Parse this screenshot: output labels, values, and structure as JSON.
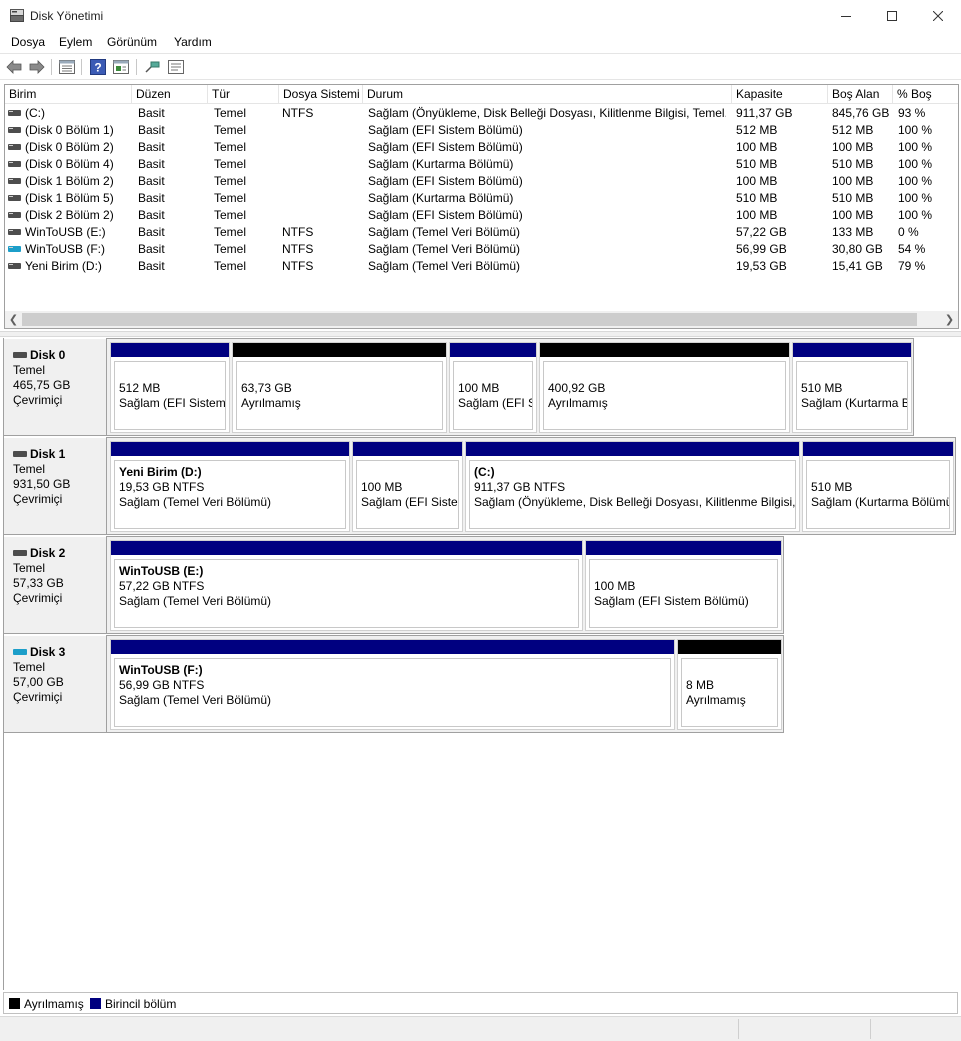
{
  "window": {
    "title": "Disk Yönetimi"
  },
  "menu": [
    "Dosya",
    "Eylem",
    "Görünüm",
    "Yardım"
  ],
  "toolbar": {
    "icons": [
      "back-arrow-icon",
      "forward-arrow-icon",
      "volume-list-icon",
      "help-icon",
      "properties-icon",
      "connect-icon",
      "console-icon"
    ]
  },
  "list": {
    "headers": [
      "Birim",
      "Düzen",
      "Tür",
      "Dosya Sistemi",
      "Durum",
      "Kapasite",
      "Boş Alan",
      "% Boş"
    ],
    "rows": [
      {
        "icon": "drive",
        "cells": [
          "(C:)",
          "Basit",
          "Temel",
          "NTFS",
          "Sağlam (Önyükleme, Disk Belleği Dosyası, Kilitlenme Bilgisi, Temel...",
          "911,37 GB",
          "845,76 GB",
          "93 %"
        ]
      },
      {
        "icon": "drive",
        "cells": [
          "(Disk 0 Bölüm 1)",
          "Basit",
          "Temel",
          "",
          "Sağlam (EFI Sistem Bölümü)",
          "512 MB",
          "512 MB",
          "100 %"
        ]
      },
      {
        "icon": "drive",
        "cells": [
          "(Disk 0 Bölüm 2)",
          "Basit",
          "Temel",
          "",
          "Sağlam (EFI Sistem Bölümü)",
          "100 MB",
          "100 MB",
          "100 %"
        ]
      },
      {
        "icon": "drive",
        "cells": [
          "(Disk 0 Bölüm 4)",
          "Basit",
          "Temel",
          "",
          "Sağlam (Kurtarma Bölümü)",
          "510 MB",
          "510 MB",
          "100 %"
        ]
      },
      {
        "icon": "drive",
        "cells": [
          "(Disk 1 Bölüm 2)",
          "Basit",
          "Temel",
          "",
          "Sağlam (EFI Sistem Bölümü)",
          "100 MB",
          "100 MB",
          "100 %"
        ]
      },
      {
        "icon": "drive",
        "cells": [
          "(Disk 1 Bölüm 5)",
          "Basit",
          "Temel",
          "",
          "Sağlam (Kurtarma Bölümü)",
          "510 MB",
          "510 MB",
          "100 %"
        ]
      },
      {
        "icon": "drive",
        "cells": [
          "(Disk 2 Bölüm 2)",
          "Basit",
          "Temel",
          "",
          "Sağlam (EFI Sistem Bölümü)",
          "100 MB",
          "100 MB",
          "100 %"
        ]
      },
      {
        "icon": "drive",
        "cells": [
          "WinToUSB (E:)",
          "Basit",
          "Temel",
          "NTFS",
          "Sağlam (Temel Veri Bölümü)",
          "57,22 GB",
          "133 MB",
          "0 %"
        ]
      },
      {
        "icon": "usb",
        "cells": [
          "WinToUSB (F:)",
          "Basit",
          "Temel",
          "NTFS",
          "Sağlam (Temel Veri Bölümü)",
          "56,99 GB",
          "30,80 GB",
          "54 %"
        ]
      },
      {
        "icon": "drive",
        "cells": [
          "Yeni Birim (D:)",
          "Basit",
          "Temel",
          "NTFS",
          "Sağlam (Temel Veri Bölümü)",
          "19,53 GB",
          "15,41 GB",
          "79 %"
        ]
      }
    ]
  },
  "disks": [
    {
      "name": "Disk 0",
      "type": "Temel",
      "size": "465,75 GB",
      "state": "Çevrimiçi",
      "icon": "drive",
      "partitions": [
        {
          "kind": "primary",
          "name": "",
          "line1": "512 MB",
          "line2": "Sağlam (EFI Sistem Bölümü)"
        },
        {
          "kind": "unalloc",
          "name": "",
          "line1": "63,73 GB",
          "line2": "Ayrılmamış"
        },
        {
          "kind": "primary",
          "name": "",
          "line1": "100 MB",
          "line2": "Sağlam (EFI Sistem Bölümü)"
        },
        {
          "kind": "unalloc",
          "name": "",
          "line1": "400,92 GB",
          "line2": "Ayrılmamış"
        },
        {
          "kind": "primary",
          "name": "",
          "line1": "510 MB",
          "line2": "Sağlam (Kurtarma Bölümü)"
        }
      ]
    },
    {
      "name": "Disk 1",
      "type": "Temel",
      "size": "931,50 GB",
      "state": "Çevrimiçi",
      "icon": "drive",
      "partitions": [
        {
          "kind": "primary",
          "name": "Yeni Birim  (D:)",
          "line1": "19,53 GB NTFS",
          "line2": "Sağlam (Temel Veri Bölümü)"
        },
        {
          "kind": "primary",
          "name": "",
          "line1": "100 MB",
          "line2": "Sağlam (EFI Sistem Bölümü)"
        },
        {
          "kind": "primary",
          "name": " (C:)",
          "line1": "911,37 GB NTFS",
          "line2": "Sağlam (Önyükleme, Disk Belleği Dosyası, Kilitlenme Bilgisi, Temel Veri Bölümü)"
        },
        {
          "kind": "primary",
          "name": "",
          "line1": "510 MB",
          "line2": "Sağlam (Kurtarma Bölümü)"
        }
      ]
    },
    {
      "name": "Disk 2",
      "type": "Temel",
      "size": "57,33 GB",
      "state": "Çevrimiçi",
      "icon": "drive",
      "partitions": [
        {
          "kind": "primary",
          "name": "WinToUSB  (E:)",
          "line1": "57,22 GB NTFS",
          "line2": "Sağlam (Temel Veri Bölümü)"
        },
        {
          "kind": "primary",
          "name": "",
          "line1": "100 MB",
          "line2": "Sağlam (EFI Sistem Bölümü)"
        }
      ]
    },
    {
      "name": "Disk 3",
      "type": "Temel",
      "size": "57,00 GB",
      "state": "Çevrimiçi",
      "icon": "usb",
      "partitions": [
        {
          "kind": "primary",
          "name": "WinToUSB  (F:)",
          "line1": "56,99 GB NTFS",
          "line2": "Sağlam (Temel Veri Bölümü)"
        },
        {
          "kind": "unalloc",
          "name": "",
          "line1": "8 MB",
          "line2": "Ayrılmamış"
        }
      ]
    }
  ],
  "legend": {
    "unallocated": "Ayrılmamış",
    "primary": "Birincil bölüm"
  },
  "colors": {
    "primary_bar": "#000080",
    "unallocated_bar": "#000000",
    "usb_drive": "#1c9ec9"
  }
}
